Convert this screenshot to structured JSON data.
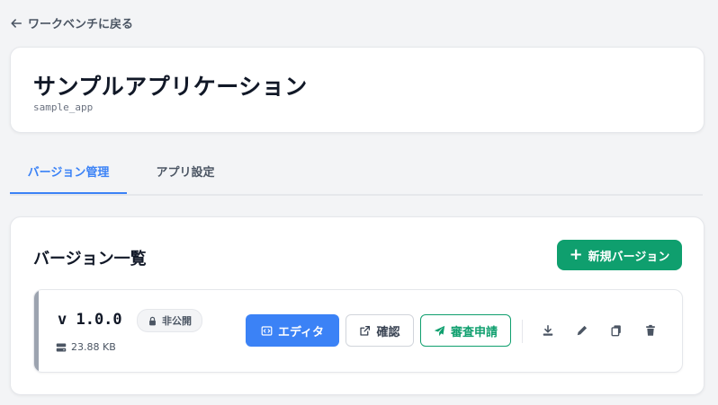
{
  "nav": {
    "back_label": "ワークベンチに戻る"
  },
  "app": {
    "title": "サンプルアプリケーション",
    "id": "sample_app"
  },
  "tabs": [
    {
      "label": "バージョン管理",
      "active": true
    },
    {
      "label": "アプリ設定",
      "active": false
    }
  ],
  "versions": {
    "title": "バージョン一覧",
    "new_button_label": "新規バージョン",
    "items": [
      {
        "version": "v 1.0.0",
        "status": "非公開",
        "size": "23.88 KB",
        "actions": {
          "editor": "エディタ",
          "preview": "確認",
          "review": "審査申請"
        }
      }
    ]
  },
  "colors": {
    "accent_blue": "#3b82f6",
    "accent_green": "#0f9f6e",
    "row_accent": "#9ca3af"
  },
  "icons": [
    "arrow-left-icon",
    "plus-icon",
    "lock-icon",
    "storage-icon",
    "code-icon",
    "external-link-icon",
    "send-icon",
    "download-icon",
    "pencil-icon",
    "copy-icon",
    "trash-icon"
  ]
}
